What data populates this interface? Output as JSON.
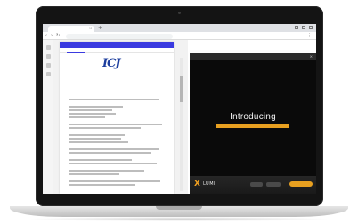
{
  "browser": {
    "tab_label": "",
    "address": ""
  },
  "document": {
    "header_text": "",
    "tabs": [
      "",
      "",
      "",
      ""
    ],
    "logo_text": "ICJ",
    "logo_subtext": "",
    "title": "",
    "subtitle": ""
  },
  "video": {
    "panel_title": "",
    "intro_text": "Introducing",
    "brand": "LUMI",
    "brand_mark": "X"
  },
  "colors": {
    "doc_header": "#3a3ae0",
    "logo": "#1d3e9e",
    "accent_orange": "#e8a020",
    "video_bg": "#0a0a0a"
  }
}
